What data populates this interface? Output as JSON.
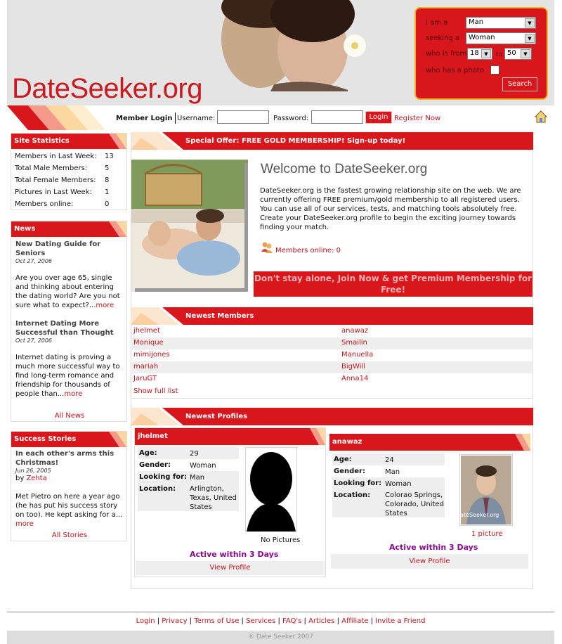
{
  "header": {
    "logo_text": "DateSeeker.org",
    "search": {
      "i_am_label": "I am a",
      "i_am_value": "Man",
      "seeking_label": "seeking a",
      "seeking_value": "Woman",
      "age_label": "who is from",
      "age_from": "18",
      "age_to_label": "to",
      "age_to": "50",
      "photo_label": "who has a photo",
      "search_button": "Search"
    }
  },
  "login": {
    "member_login": "Member Login",
    "username_label": "Username:",
    "password_label": "Password:",
    "login_button": "Login",
    "register_link": "Register Now"
  },
  "stats": {
    "title": "Site Statistics",
    "rows": [
      {
        "label": "Members in Last Week:",
        "value": "13"
      },
      {
        "label": "Total Male Members:",
        "value": "5"
      },
      {
        "label": "Total Female Members:",
        "value": "8"
      },
      {
        "label": "Pictures in Last Week:",
        "value": "1"
      },
      {
        "label": "Members online:",
        "value": "0"
      }
    ]
  },
  "news": {
    "title": "News",
    "items": [
      {
        "title": "New Dating Guide for Seniors",
        "date": "Oct 27, 2006",
        "body": "Are you over age 65, single and thinking about entering the dating world? Are you not sure what to expect?...",
        "more": "more"
      },
      {
        "title": "Internet Dating More Successful than Thought",
        "date": "Oct 27, 2006",
        "body": "Internet dating is proving a much more successful way to find long-term romance and friendship for thousands of people than...",
        "more": "more"
      }
    ],
    "all_link": "All News"
  },
  "stories": {
    "title": "Success Stories",
    "item_title": "In each other's arms this Christmas!",
    "date": "Jun 26, 2005",
    "by_label": "by",
    "author": "Zehta",
    "body": "Met Pietro on here a year ago (he has put his success story on too). He kept asking for a...",
    "more": "more",
    "all_link": "All Stories"
  },
  "offer": {
    "banner": "Special Offer: FREE GOLD MEMBERSHIP! Sign-up today!"
  },
  "welcome": {
    "title": "Welcome to DateSeeker.org",
    "body": "DateSeeker.org is the fastest growing relationship site on the web. We are currently offering FREE premium/gold membership to all registered users. You can use all of our services, tests, and matching tools absolutely free. Create your DateSeeker.org profile to begin the exciting journey towards finding your match.",
    "online_text": "Members online: 0",
    "join_banner": "Don't stay alone, Join Now & get Premium Membership for Free!"
  },
  "newest_members": {
    "title": "Newest Members",
    "rows": [
      [
        "jhelmet",
        "anawaz"
      ],
      [
        "Monique",
        "Smailin"
      ],
      [
        "mimijones",
        "Manuella"
      ],
      [
        "mariah",
        "BigWill"
      ],
      [
        "JaruGT",
        "Anna14"
      ]
    ],
    "show_full": "Show full list"
  },
  "newest_profiles": {
    "title": "Newest Profiles",
    "labels": {
      "age": "Age:",
      "gender": "Gender:",
      "looking": "Looking for:",
      "location": "Location:"
    },
    "profiles": [
      {
        "name": "jhelmet",
        "age": "29",
        "gender": "Woman",
        "looking": "Man",
        "location": "Arlington, Texas, United States",
        "pictures": "No Pictures",
        "active": "Active within 3 Days",
        "view": "View Profile"
      },
      {
        "name": "anawaz",
        "age": "24",
        "gender": "Man",
        "looking": "Woman",
        "location": "Colorao Springs, Colorado, United States",
        "pictures": "1 picture",
        "photo_watermark": "ateSeeker.org",
        "active": "Active within 3 Days",
        "view": "View Profile"
      }
    ]
  },
  "footer": {
    "links": [
      "Login",
      "Privacy",
      "Terms of Use",
      "Services",
      "FAQ's",
      "Articles",
      "Affiliate",
      "Invite a Friend"
    ],
    "copyright": "® Date Seeker 2007"
  },
  "colors": {
    "brand_red": "#d8161b",
    "accent_yellow": "#f2b422",
    "active_purple": "#8a0a8f"
  }
}
